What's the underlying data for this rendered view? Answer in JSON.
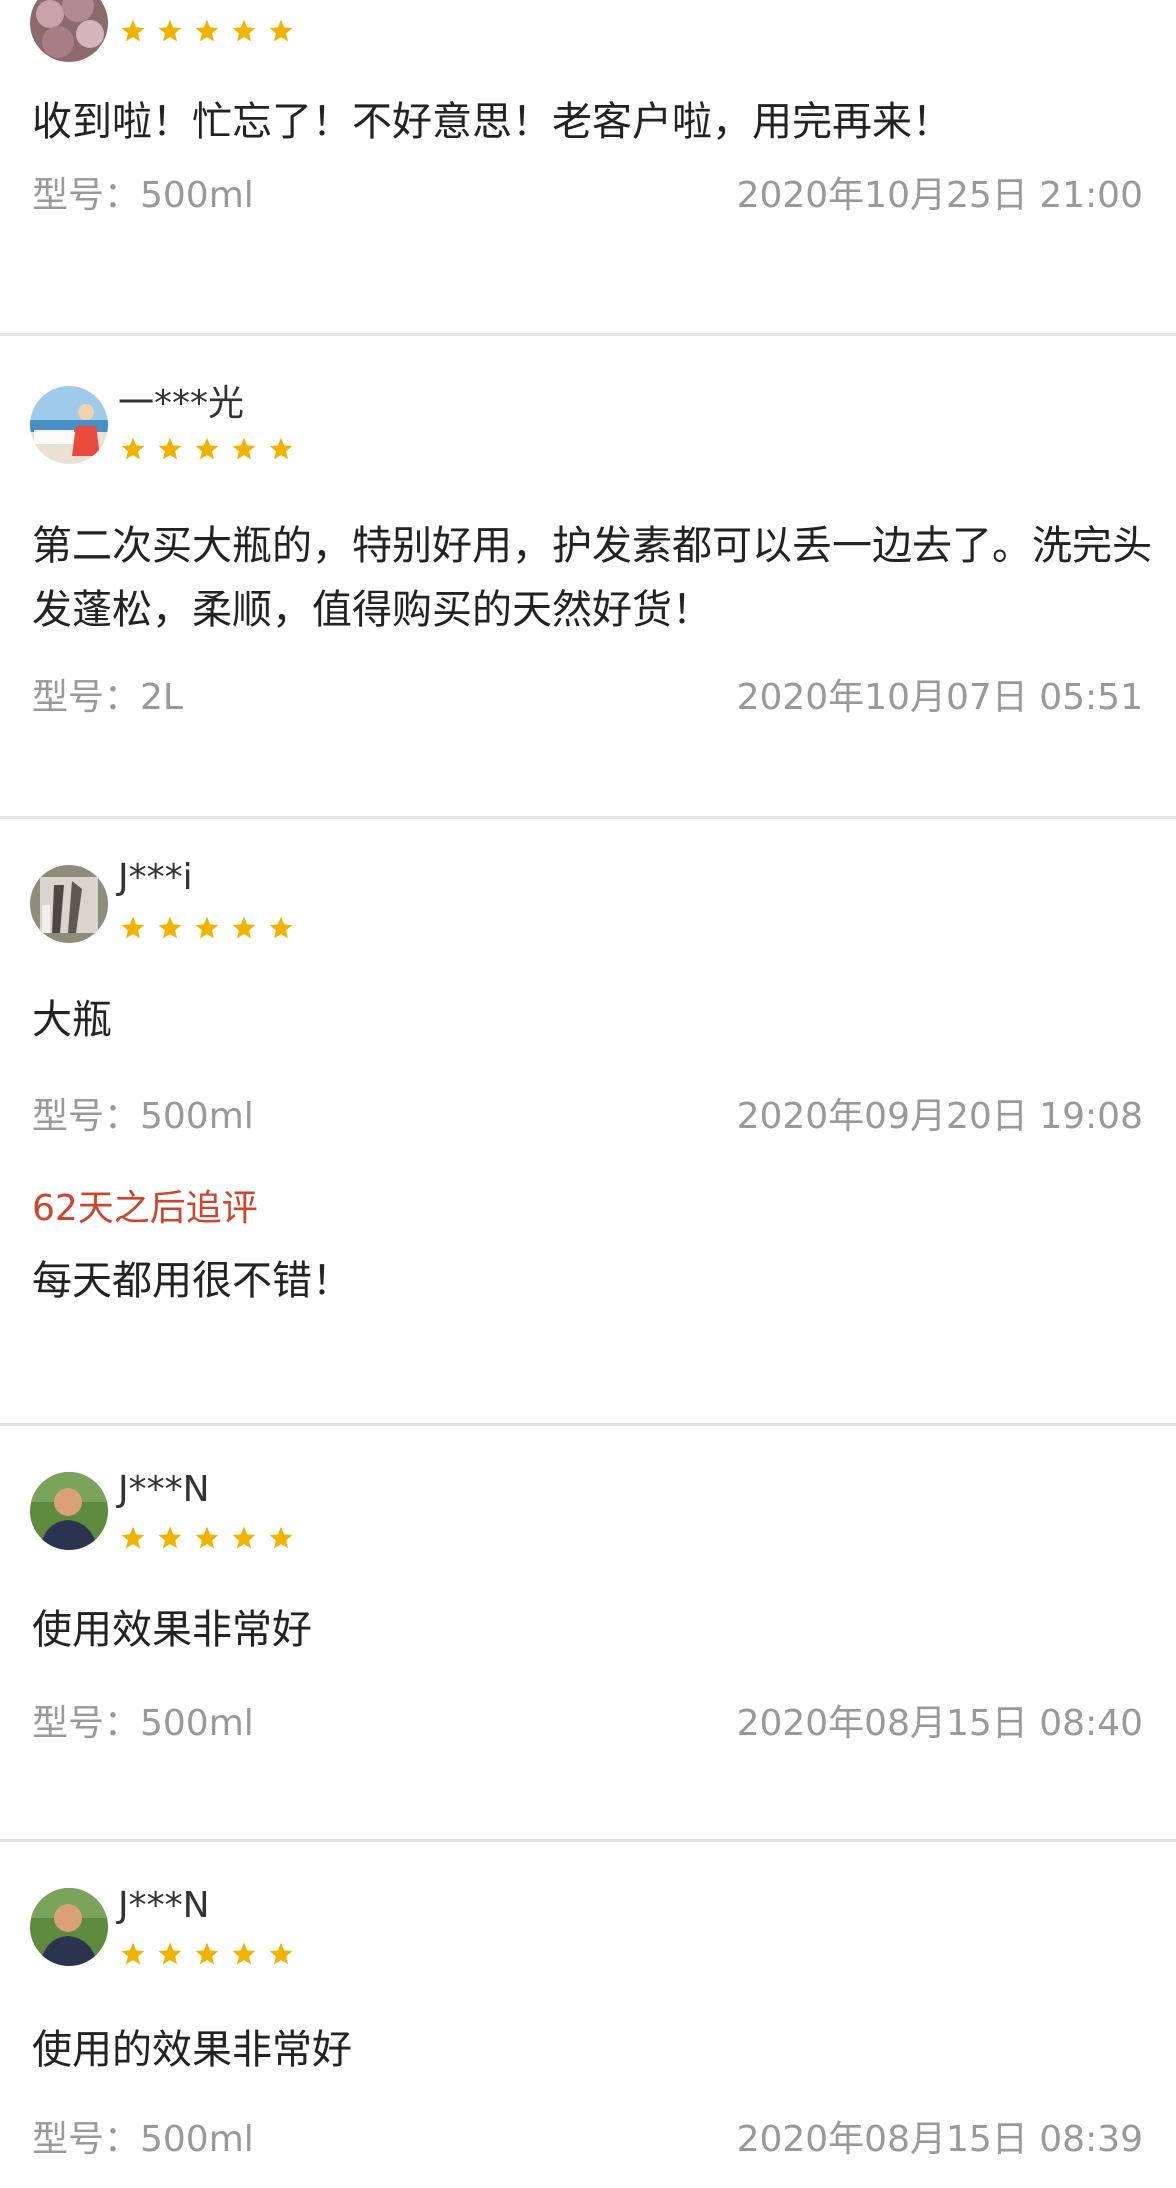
{
  "colors": {
    "star": "#f2b300",
    "followup": "#d0442c",
    "meta_text": "#999999",
    "divider": "#e4e4e4"
  },
  "reviews": [
    {
      "username": "",
      "rating": 5,
      "avatar": "pink-blossom-avatar",
      "content": "收到啦！忙忘了！不好意思！老客户啦，用完再来！",
      "spec": "型号：500ml",
      "date": "2020年10月25日 21:00"
    },
    {
      "username": "一***光",
      "rating": 5,
      "avatar": "beach-avatar",
      "content": "第二次买大瓶的，特别好用，护发素都可以丢一边去了。洗完头发蓬松，柔顺，值得购买的天然好货！",
      "spec": "型号：2L",
      "date": "2020年10月07日 05:51"
    },
    {
      "username": "J***i",
      "rating": 5,
      "avatar": "statue-avatar",
      "content": "大瓶",
      "spec": "型号：500ml",
      "date": "2020年09月20日 19:08",
      "followup_label": "62天之后追评",
      "followup_text": "每天都用很不错！"
    },
    {
      "username": "J***N",
      "rating": 5,
      "avatar": "person-avatar",
      "content": "使用效果非常好",
      "spec": "型号：500ml",
      "date": "2020年08月15日 08:40"
    },
    {
      "username": "J***N",
      "rating": 5,
      "avatar": "person-avatar",
      "content": "使用的效果非常好",
      "spec": "型号：500ml",
      "date": "2020年08月15日 08:39"
    }
  ]
}
